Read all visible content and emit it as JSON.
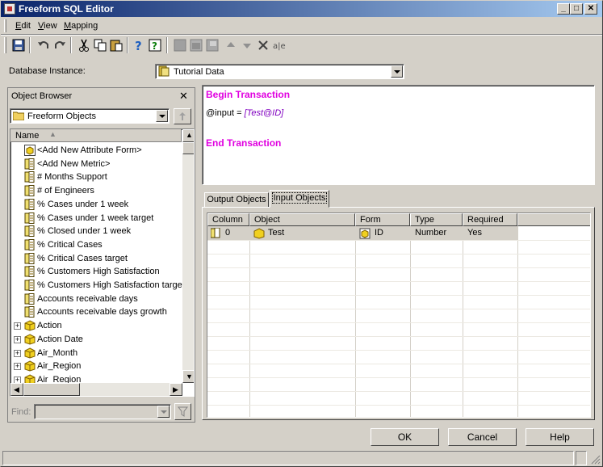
{
  "window": {
    "title": "Freeform SQL Editor"
  },
  "menu": [
    {
      "label": "Edit",
      "key": "E"
    },
    {
      "label": "View",
      "key": "V"
    },
    {
      "label": "Mapping",
      "key": "M"
    }
  ],
  "database_instance": {
    "label": "Database Instance:",
    "value": "Tutorial Data"
  },
  "object_browser": {
    "title": "Object Browser",
    "folder": "Freeform Objects",
    "column_header": "Name",
    "items": [
      {
        "label": "<Add New Attribute Form>",
        "icon": "attribute-form-icon",
        "expander": false
      },
      {
        "label": "<Add New Metric>",
        "icon": "metric-icon",
        "expander": false
      },
      {
        "label": "# Months Support",
        "icon": "metric-icon",
        "expander": false
      },
      {
        "label": "# of Engineers",
        "icon": "metric-icon",
        "expander": false
      },
      {
        "label": "% Cases under 1 week",
        "icon": "metric-icon",
        "expander": false
      },
      {
        "label": "% Cases under 1 week target",
        "icon": "metric-icon",
        "expander": false
      },
      {
        "label": "% Closed under 1 week",
        "icon": "metric-icon",
        "expander": false
      },
      {
        "label": "% Critical Cases",
        "icon": "metric-icon",
        "expander": false
      },
      {
        "label": "% Critical Cases target",
        "icon": "metric-icon",
        "expander": false
      },
      {
        "label": "% Customers High Satisfaction",
        "icon": "metric-icon",
        "expander": false
      },
      {
        "label": "% Customers High Satisfaction target",
        "icon": "metric-icon",
        "expander": false
      },
      {
        "label": "Accounts receivable days",
        "icon": "metric-icon",
        "expander": false
      },
      {
        "label": "Accounts receivable days growth",
        "icon": "metric-icon",
        "expander": false
      },
      {
        "label": "Action",
        "icon": "attribute-icon",
        "expander": true
      },
      {
        "label": "Action Date",
        "icon": "attribute-icon",
        "expander": true
      },
      {
        "label": "Air_Month",
        "icon": "attribute-icon",
        "expander": true
      },
      {
        "label": "Air_Region",
        "icon": "attribute-icon",
        "expander": true
      },
      {
        "label": "Air_Region",
        "icon": "attribute-icon",
        "expander": true
      }
    ],
    "find_label": "Find:"
  },
  "sql": {
    "begin": "Begin Transaction",
    "input_prefix": "@input = ",
    "input_value": "[Test@ID]",
    "end": "End Transaction"
  },
  "tabs": [
    {
      "label": "Output Objects",
      "active": false
    },
    {
      "label": "Input Objects",
      "active": true
    }
  ],
  "grid": {
    "columns": [
      "Column",
      "Object",
      "Form",
      "Type",
      "Required"
    ],
    "rows": [
      {
        "column": "0",
        "object": "Test",
        "form": "ID",
        "type": "Number",
        "required": "Yes"
      }
    ]
  },
  "buttons": {
    "ok": "OK",
    "cancel": "Cancel",
    "help": "Help"
  },
  "colors": {
    "sql_keyword": "#e000e0",
    "sql_param": "#8000c0",
    "title_start": "#0a246a",
    "title_end": "#a6caf0"
  }
}
